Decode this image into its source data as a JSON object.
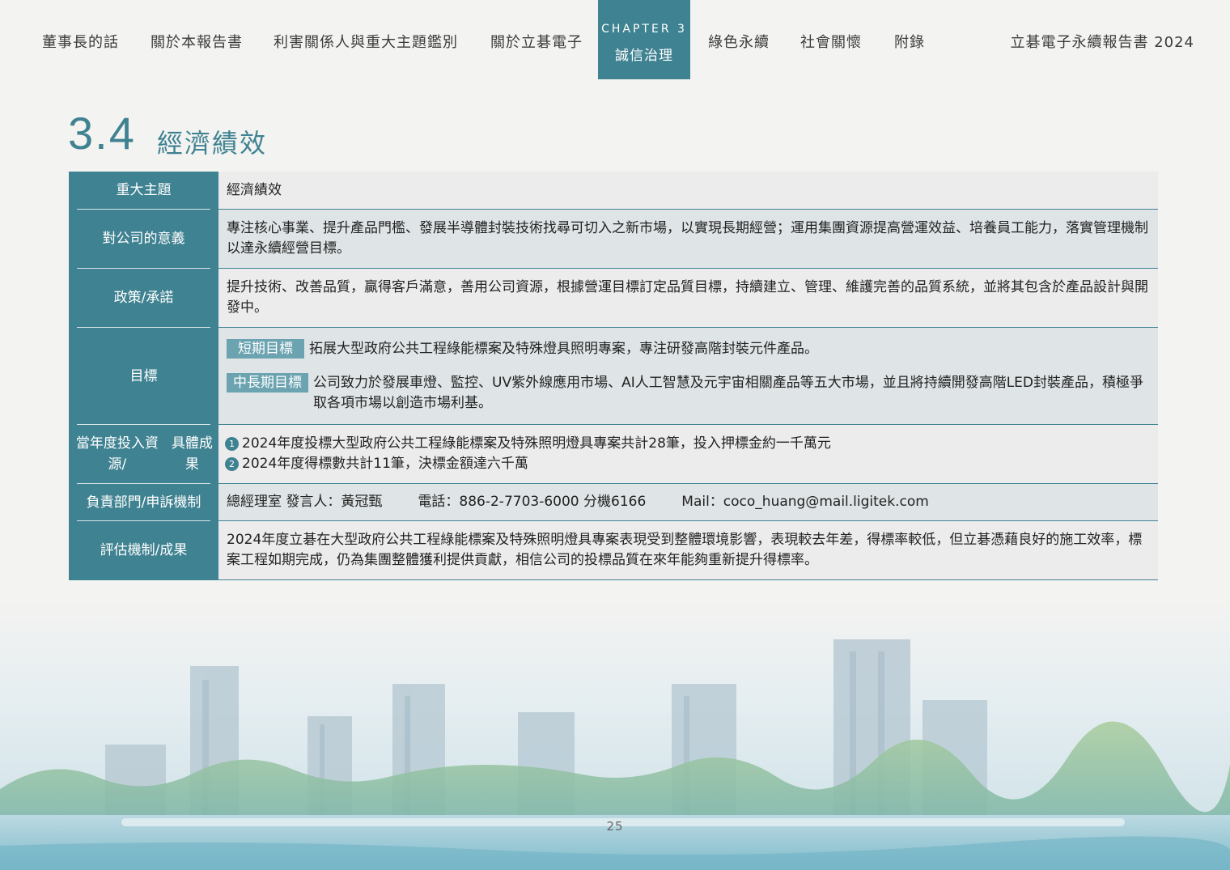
{
  "nav": {
    "items": [
      "董事長的話",
      "關於本報告書",
      "利害關係人與重大主題鑑別",
      "關於立碁電子"
    ],
    "active": {
      "chapter": "CHAPTER 3",
      "title": "誠信治理"
    },
    "items_right": [
      "綠色永續",
      "社會關懷",
      "附錄"
    ],
    "report_title": "立碁電子永續報告書 2024"
  },
  "heading": {
    "number": "3.4",
    "title": "經濟績效"
  },
  "table": {
    "topic": {
      "label": "重大主題",
      "value": "經濟績效"
    },
    "meaning": {
      "label": "對公司的意義",
      "value": "專注核心事業、提升產品門檻、發展半導體封裝技術找尋可切入之新市場，以實現長期經營；運用集團資源提高營運效益、培養員工能力，落實管理機制以達永續經營目標。"
    },
    "policy": {
      "label": "政策/承諾",
      "value": "提升技術、改善品質，贏得客戶滿意，善用公司資源，根據營運目標訂定品質目標，持續建立、管理、維護完善的品質系統，並將其包含於產品設計與開發中。"
    },
    "goals": {
      "label": "目標",
      "short_tag": "短期目標",
      "short_text": "拓展大型政府公共工程綠能標案及特殊燈具照明專案，專注研發高階封裝元件產品。",
      "long_tag": "中長期目標",
      "long_text": "公司致力於發展車燈、監控、UV紫外線應用市場、AI人工智慧及元宇宙相關產品等五大市場，並且將持續開發高階LED封裝產品，積極爭取各項市場以創造市場利基。"
    },
    "resources": {
      "label_line1": "當年度投入資源/",
      "label_line2": "具體成果",
      "item1_num": "1",
      "item1": "2024年度投標大型政府公共工程綠能標案及特殊照明燈具專案共計28筆，投入押標金約一千萬元",
      "item2_num": "2",
      "item2": "2024年度得標數共計11筆，決標金額達六千萬"
    },
    "contact": {
      "label": "負責部門/申訴機制",
      "dept": "總經理室 發言人：黃冠甄",
      "phone": "電話：886-2-7703-6000 分機6166",
      "mail": "Mail：coco_huang@mail.ligitek.com"
    },
    "evaluation": {
      "label": "評估機制/成果",
      "value": "2024年度立碁在大型政府公共工程綠能標案及特殊照明燈具專案表現受到整體環境影響，表現較去年差，得標率較低，但立碁憑藉良好的施工效率，標案工程如期完成，仍為集團整體獲利提供貢獻，相信公司的投標品質在來年能夠重新提升得標率。"
    }
  },
  "footer": {
    "page_number": "25"
  },
  "colors": {
    "accent": "#3f8291",
    "tag": "#6ba3b0",
    "row_light": "#ececec",
    "row_blue": "#dfe4e6"
  }
}
